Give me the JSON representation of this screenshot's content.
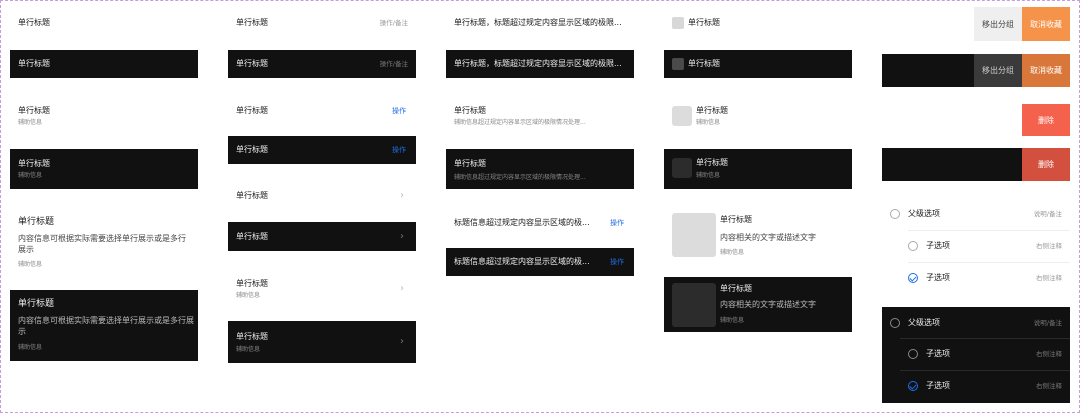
{
  "col1": {
    "r1_title": "单行标题",
    "r2_title": "单行标题",
    "r3_title": "单行标题",
    "r3_sub": "辅助信息",
    "r4_title": "单行标题",
    "r4_sub": "辅助信息",
    "r5_title": "单行标题",
    "r5_body": "内容信息可根据实际需要选择单行展示或是多行展示",
    "r5_sub": "辅助信息",
    "r6_title": "单行标题",
    "r6_body": "内容信息可根据实际需要选择单行展示或是多行展示",
    "r6_sub": "辅助信息"
  },
  "col2": {
    "r1_title": "单行标题",
    "r1_note": "操作/备注",
    "r2_title": "单行标题",
    "r2_note": "操作/备注",
    "r3_title": "单行标题",
    "r3_action": "操作",
    "r4_title": "单行标题",
    "r4_action": "操作",
    "r5_title": "单行标题",
    "r6_title": "单行标题",
    "r7_title": "单行标题",
    "r7_sub": "辅助信息",
    "r8_title": "单行标题",
    "r8_sub": "辅助信息",
    "chevron": "›"
  },
  "col3": {
    "r1_title": "单行标题，标题超过规定内容显示区域的极限...",
    "r2_title": "单行标题，标题超过规定内容显示区域的极限...",
    "r3_title": "单行标题",
    "r3_sub": "辅助信息超过规定内容显示区域的极限情况处理...",
    "r4_title": "单行标题",
    "r4_sub": "辅助信息超过规定内容显示区域的极限情况处理...",
    "r5_title": "标题信息超过规定内容显示区域的极...",
    "r5_action": "操作",
    "r6_title": "标题信息超过规定内容显示区域的极...",
    "r6_action": "操作"
  },
  "col4": {
    "r1_title": "单行标题",
    "r2_title": "单行标题",
    "r3_title": "单行标题",
    "r3_sub": "辅助信息",
    "r4_title": "单行标题",
    "r4_sub": "辅助信息",
    "r5_title": "单行标题",
    "r5_body": "内容相关的文字或描述文字",
    "r5_sub": "辅助信息",
    "r6_title": "单行标题",
    "r6_body": "内容相关的文字或描述文字",
    "r6_sub": "辅助信息"
  },
  "col5": {
    "move_label": "移出分组",
    "unfav_label": "取消收藏",
    "delete_label": "删除",
    "parent_label": "父级选项",
    "parent_note": "说明/备注",
    "child_label": "子选项",
    "child_note": "右侧注释",
    "colors": {
      "move_light": "#efefef",
      "move_dark": "#3a3a3a",
      "unfav_light": "#f5934a",
      "unfav_dark": "#d9773a",
      "delete_light": "#f4624d",
      "delete_dark": "#d4503e",
      "accent": "#1e6ee8"
    }
  }
}
